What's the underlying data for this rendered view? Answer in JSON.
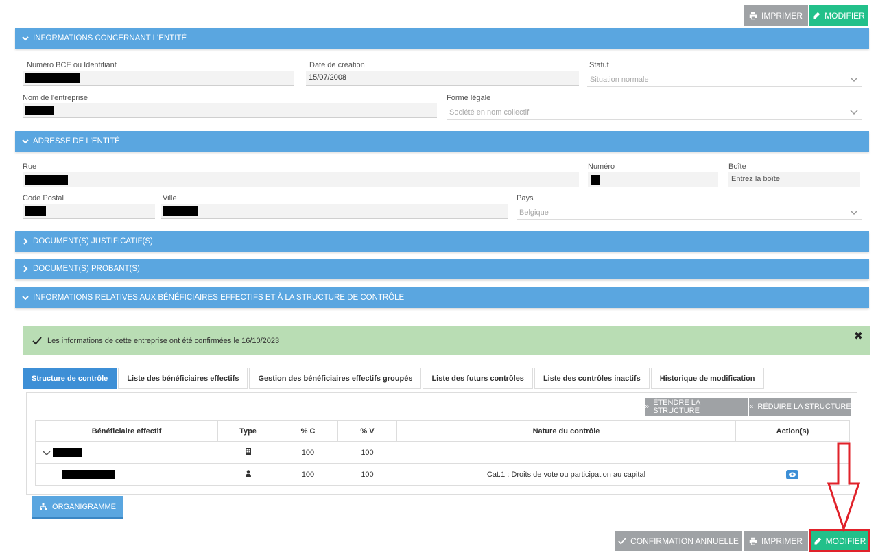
{
  "toolbar_top": {
    "print_label": "IMPRIMER",
    "modify_label": "MODIFIER"
  },
  "section_entity": {
    "title": "INFORMATIONS CONCERNANT L'ENTITÉ",
    "bce_label": "Numéro BCE ou Identifiant",
    "creation_label": "Date de création",
    "creation_value": "15/07/2008",
    "status_label": "Statut",
    "status_value": "Situation normale",
    "company_name_label": "Nom de l'entreprise",
    "legal_form_label": "Forme légale",
    "legal_form_value": "Société en nom collectif"
  },
  "section_address": {
    "title": "ADRESSE DE L'ENTITÉ",
    "street_label": "Rue",
    "number_label": "Numéro",
    "box_label": "Boîte",
    "box_placeholder": "Entrez la boîte",
    "postal_label": "Code Postal",
    "city_label": "Ville",
    "country_label": "Pays",
    "country_value": "Belgique"
  },
  "section_docs": {
    "title": "DOCUMENT(S) JUSTIFICATIF(S)"
  },
  "section_proof": {
    "title": "DOCUMENT(S) PROBANT(S)"
  },
  "section_beneficiaries": {
    "title": "INFORMATIONS RELATIVES AUX BÉNÉFICIAIRES EFFECTIFS ET À LA STRUCTURE DE CONTRÔLE"
  },
  "alert": {
    "text": "Les informations de cette entreprise ont été confirmées le 16/10/2023",
    "close": "✖"
  },
  "tabs": [
    {
      "label": "Structure de contrôle"
    },
    {
      "label": "Liste des bénéficiaires effectifs"
    },
    {
      "label": "Gestion des bénéficiaires effectifs groupés"
    },
    {
      "label": "Liste des futurs contrôles"
    },
    {
      "label": "Liste des contrôles inactifs"
    },
    {
      "label": "Historique de modification"
    }
  ],
  "structure_buttons": {
    "expand": "ÉTENDRE LA STRUCTURE",
    "collapse": "RÉDUIRE LA STRUCTURE"
  },
  "table": {
    "headers": [
      "Bénéficiaire effectif",
      "Type",
      "% C",
      "% V",
      "Nature du contrôle",
      "Action(s)"
    ],
    "rows": [
      {
        "type_icon": "building-icon",
        "c": "100",
        "v": "100",
        "nature": ""
      },
      {
        "type_icon": "person-icon",
        "c": "100",
        "v": "100",
        "nature": "Cat.1 : Droits de vote ou participation au capital"
      }
    ]
  },
  "org_button": {
    "label": "ORGANIGRAMME"
  },
  "toolbar_bottom": {
    "confirm_label": "CONFIRMATION ANNUELLE",
    "print_label": "IMPRIMER",
    "modify_label": "MODIFIER"
  },
  "colors": {
    "section_blue": "#5aa6e0",
    "tab_active": "#3d8fd6",
    "green": "#22c08a",
    "grey": "#9fa2a5",
    "alert_bg": "#b9ddb4",
    "highlight_red": "#e0222a"
  }
}
